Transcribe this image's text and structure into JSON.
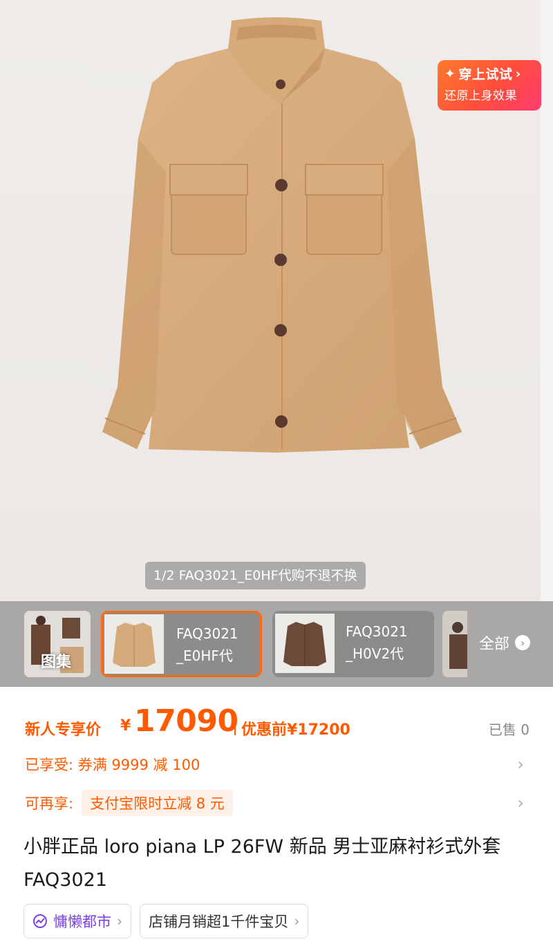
{
  "hero": {
    "try_on_title": "穿上试试",
    "try_on_subtitle": "还原上身效果",
    "caption": "1/2 FAQ3021_E0HF代购不退不换"
  },
  "variants": {
    "album_label": "图集",
    "cards": [
      {
        "line1": "FAQ3021",
        "line2": "_E0HF代",
        "selected": true,
        "color": "#d6ab7c"
      },
      {
        "line1": "FAQ3021",
        "line2": "_H0V2代",
        "selected": false,
        "color": "#6c4a3a"
      }
    ],
    "all_label": "全部"
  },
  "price": {
    "label": "新人专享价",
    "currency": "¥",
    "amount": "17090",
    "before": "优惠前¥17200",
    "sold": "已售 0"
  },
  "offers": {
    "enjoyed": "已享受: 券满 9999 减 100",
    "more_label": "可再享:",
    "more_tag": "支付宝限时立减 8 元"
  },
  "title": "小胖正品 loro piana LP 26FW 新品 男士亚麻衬衫式外套 FAQ3021",
  "chips": {
    "shop_tag": "慵懒都市",
    "sales": "店铺月销超1千件宝贝"
  },
  "colors": {
    "accent": "#ff5a00",
    "jacket": "#d8ad7e",
    "button": "#5a3a2e"
  }
}
